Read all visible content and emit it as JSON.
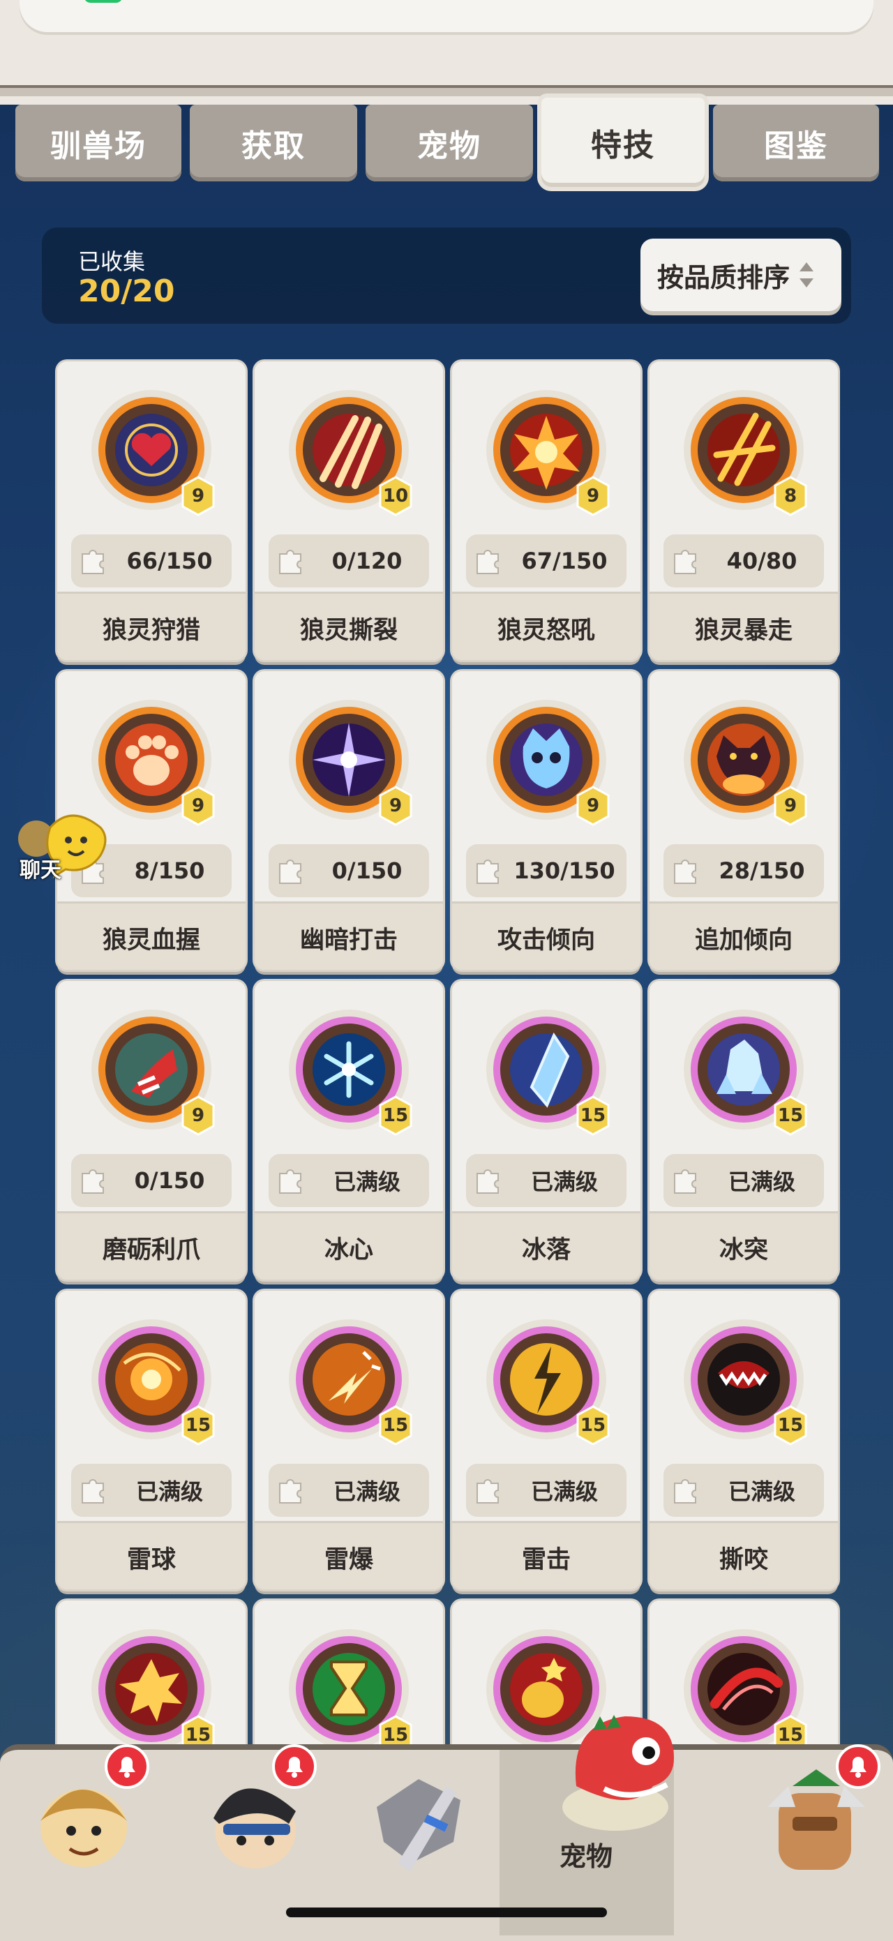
{
  "tabs": [
    {
      "label": "驯兽场",
      "active": false
    },
    {
      "label": "获取",
      "active": false
    },
    {
      "label": "宠物",
      "active": false
    },
    {
      "label": "特技",
      "active": true
    },
    {
      "label": "图鉴",
      "active": false
    }
  ],
  "collection": {
    "label": "已收集",
    "value": "20/20"
  },
  "sort": {
    "label": "按品质排序"
  },
  "skills": [
    {
      "name": "狼灵狩猎",
      "level": "9",
      "progress": "66/150",
      "frame": "orange",
      "icon": "heart-shield-icon"
    },
    {
      "name": "狼灵撕裂",
      "level": "10",
      "progress": "0/120",
      "frame": "orange",
      "icon": "claw-slash-icon"
    },
    {
      "name": "狼灵怒吼",
      "level": "9",
      "progress": "67/150",
      "frame": "orange",
      "icon": "fire-burst-icon"
    },
    {
      "name": "狼灵暴走",
      "level": "8",
      "progress": "40/80",
      "frame": "orange",
      "icon": "flame-slash-icon"
    },
    {
      "name": "狼灵血握",
      "level": "9",
      "progress": "8/150",
      "frame": "orange",
      "icon": "paw-icon"
    },
    {
      "name": "幽暗打击",
      "level": "9",
      "progress": "0/150",
      "frame": "orange",
      "icon": "dark-burst-icon"
    },
    {
      "name": "攻击倾向",
      "level": "9",
      "progress": "130/150",
      "frame": "orange",
      "icon": "owl-spirit-icon"
    },
    {
      "name": "追加倾向",
      "level": "9",
      "progress": "28/150",
      "frame": "orange",
      "icon": "shadow-beast-icon"
    },
    {
      "name": "磨砺利爪",
      "level": "9",
      "progress": "0/150",
      "frame": "orange",
      "icon": "red-claw-icon"
    },
    {
      "name": "冰心",
      "level": "15",
      "progress": "已满级",
      "frame": "pink",
      "icon": "snowflake-icon"
    },
    {
      "name": "冰落",
      "level": "15",
      "progress": "已满级",
      "frame": "pink",
      "icon": "ice-shard-icon"
    },
    {
      "name": "冰突",
      "level": "15",
      "progress": "已满级",
      "frame": "pink",
      "icon": "ice-crystal-icon"
    },
    {
      "name": "雷球",
      "level": "15",
      "progress": "已满级",
      "frame": "pink",
      "icon": "thunder-orb-icon"
    },
    {
      "name": "雷爆",
      "level": "15",
      "progress": "已满级",
      "frame": "pink",
      "icon": "thunder-blast-icon"
    },
    {
      "name": "雷击",
      "level": "15",
      "progress": "已满级",
      "frame": "pink",
      "icon": "lightning-strike-icon"
    },
    {
      "name": "撕咬",
      "level": "15",
      "progress": "已满级",
      "frame": "pink",
      "icon": "fang-mouth-icon"
    },
    {
      "name": "",
      "level": "15",
      "progress": "",
      "frame": "pink",
      "icon": "explosion-icon"
    },
    {
      "name": "",
      "level": "15",
      "progress": "",
      "frame": "pink",
      "icon": "hourglass-icon"
    },
    {
      "name": "",
      "level": "",
      "progress": "",
      "frame": "pink",
      "icon": "golden-fist-icon"
    },
    {
      "name": "",
      "level": "15",
      "progress": "",
      "frame": "pink",
      "icon": "red-slash-icon"
    }
  ],
  "chat": {
    "label": "聊天",
    "icon": "chat-bubble-face-icon"
  },
  "bottom_nav": {
    "items": [
      {
        "icon": "caveman-avatar-icon",
        "notify": true
      },
      {
        "icon": "hero-avatar-icon",
        "notify": true
      },
      {
        "icon": "weapon-rock-icon",
        "notify": false
      },
      {
        "icon": "dino-pet-icon",
        "label": "宠物",
        "active": true,
        "notify": false
      },
      {
        "icon": "totem-avatar-icon",
        "notify": true
      }
    ]
  },
  "colors": {
    "frame_orange": "#f08a24",
    "frame_pink": "#e07ad6",
    "accent_gold": "#f6c84a",
    "background": "#1b3f6e"
  }
}
